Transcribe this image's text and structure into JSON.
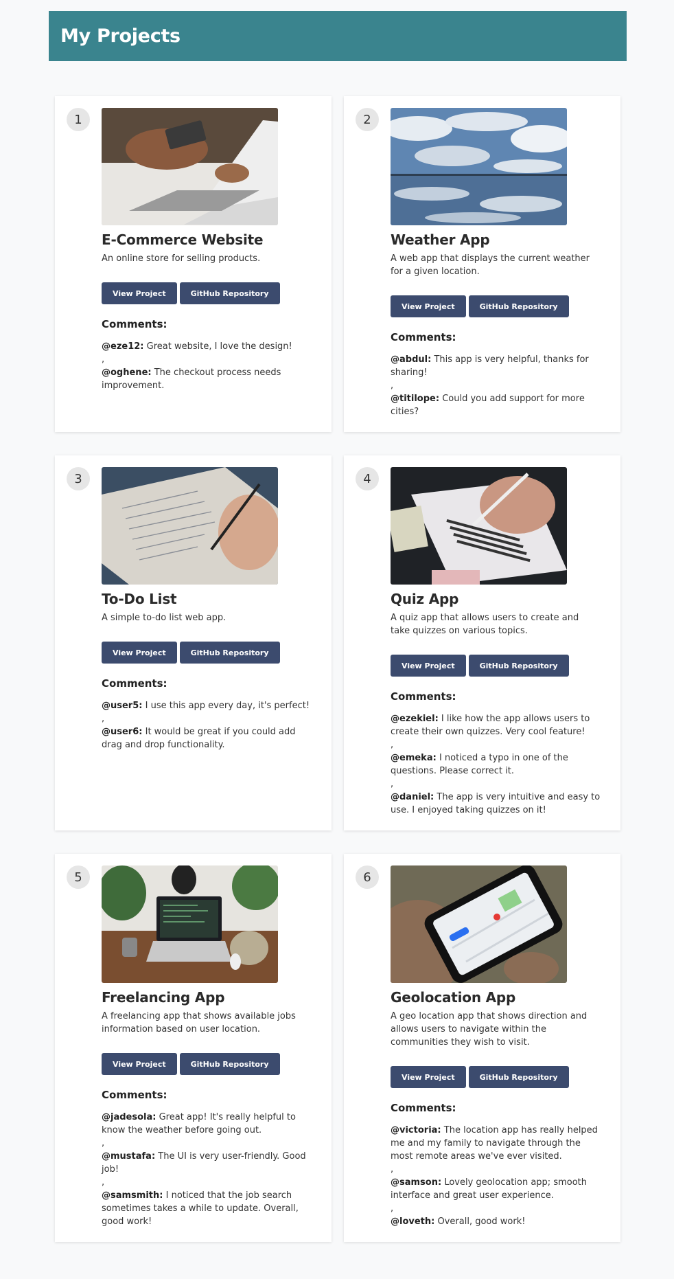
{
  "page": {
    "title": "My Projects"
  },
  "buttons": {
    "view": "View Project",
    "github": "GitHub Repository"
  },
  "comments_heading": "Comments:",
  "separator": ",",
  "projects": [
    {
      "number": "1",
      "title": "E-Commerce Website",
      "description": "An online store for selling products.",
      "image": "laptop-card-payment-photo",
      "comments": [
        {
          "user": "@eze12:",
          "text": "Great website, I love the design!"
        },
        {
          "user": "@oghene:",
          "text": "The checkout process needs improvement."
        }
      ]
    },
    {
      "number": "2",
      "title": "Weather App",
      "description": "A web app that displays the current weather for a given location.",
      "image": "sky-clouds-photo",
      "comments": [
        {
          "user": "@abdul:",
          "text": "This app is very helpful, thanks for sharing!"
        },
        {
          "user": "@titilope:",
          "text": "Could you add support for more cities?"
        }
      ]
    },
    {
      "number": "3",
      "title": "To-Do List",
      "description": "A simple to-do list web app.",
      "image": "notebook-writing-photo",
      "comments": [
        {
          "user": "@user5:",
          "text": "I use this app every day, it's perfect!"
        },
        {
          "user": "@user6:",
          "text": "It would be great if you could add drag and drop functionality."
        }
      ]
    },
    {
      "number": "4",
      "title": "Quiz App",
      "description": "A quiz app that allows users to create and take quizzes on various topics.",
      "image": "answer-sheet-photo",
      "comments": [
        {
          "user": "@ezekiel:",
          "text": "I like how the app allows users to create their own quizzes. Very cool feature!"
        },
        {
          "user": "@emeka:",
          "text": "I noticed a typo in one of the questions. Please correct it."
        },
        {
          "user": "@daniel:",
          "text": "The app is very intuitive and easy to use. I enjoyed taking quizzes on it!"
        }
      ]
    },
    {
      "number": "5",
      "title": "Freelancing App",
      "description": "A freelancing app that shows available jobs information based on user location.",
      "image": "desk-laptop-photo",
      "comments": [
        {
          "user": "@jadesola:",
          "text": "Great app! It's really helpful to know the weather before going out."
        },
        {
          "user": "@mustafa:",
          "text": "The UI is very user-friendly. Good job!"
        },
        {
          "user": "@samsmith:",
          "text": "I noticed that the job search sometimes takes a while to update. Overall, good work!"
        }
      ]
    },
    {
      "number": "6",
      "title": "Geolocation App",
      "description": "A geo location app that shows direction and allows users to navigate within the communities they wish to visit.",
      "image": "phone-map-photo",
      "comments": [
        {
          "user": "@victoria:",
          "text": "The location app has really helped me and my family to navigate through the most remote areas we've ever visited."
        },
        {
          "user": "@samson:",
          "text": "Lovely geolocation app; smooth interface and great user experience."
        },
        {
          "user": "@loveth:",
          "text": "Overall, good work!"
        }
      ]
    }
  ]
}
